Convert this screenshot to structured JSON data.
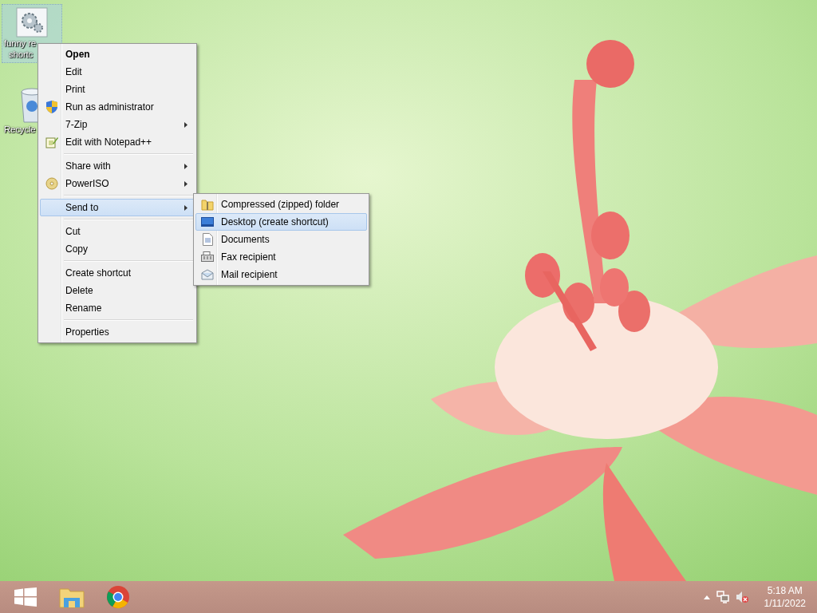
{
  "desktop_icons": [
    {
      "label_lines": [
        "funny re",
        "shortc"
      ],
      "selected": true
    },
    {
      "label_lines": [
        "Recycle"
      ],
      "selected": false
    }
  ],
  "context_menu": {
    "items": [
      {
        "kind": "item",
        "label": "Open",
        "default": true,
        "submenu": false,
        "selected": false
      },
      {
        "kind": "item",
        "label": "Edit",
        "default": false,
        "submenu": false,
        "selected": false
      },
      {
        "kind": "item",
        "label": "Print",
        "default": false,
        "submenu": false,
        "selected": false
      },
      {
        "kind": "item",
        "label": "Run as administrator",
        "default": false,
        "submenu": false,
        "selected": false
      },
      {
        "kind": "item",
        "label": "7-Zip",
        "default": false,
        "submenu": true,
        "selected": false
      },
      {
        "kind": "item",
        "label": "Edit with Notepad++",
        "default": false,
        "submenu": false,
        "selected": false
      },
      {
        "kind": "separator"
      },
      {
        "kind": "item",
        "label": "Share with",
        "default": false,
        "submenu": true,
        "selected": false
      },
      {
        "kind": "item",
        "label": "PowerISO",
        "default": false,
        "submenu": true,
        "selected": false
      },
      {
        "kind": "separator"
      },
      {
        "kind": "item",
        "label": "Send to",
        "default": false,
        "submenu": true,
        "selected": true
      },
      {
        "kind": "separator"
      },
      {
        "kind": "item",
        "label": "Cut",
        "default": false,
        "submenu": false,
        "selected": false
      },
      {
        "kind": "item",
        "label": "Copy",
        "default": false,
        "submenu": false,
        "selected": false
      },
      {
        "kind": "separator"
      },
      {
        "kind": "item",
        "label": "Create shortcut",
        "default": false,
        "submenu": false,
        "selected": false
      },
      {
        "kind": "item",
        "label": "Delete",
        "default": false,
        "submenu": false,
        "selected": false
      },
      {
        "kind": "item",
        "label": "Rename",
        "default": false,
        "submenu": false,
        "selected": false
      },
      {
        "kind": "separator"
      },
      {
        "kind": "item",
        "label": "Properties",
        "default": false,
        "submenu": false,
        "selected": false
      }
    ]
  },
  "send_to_menu": {
    "items": [
      {
        "label": "Compressed (zipped) folder",
        "selected": false
      },
      {
        "label": "Desktop (create shortcut)",
        "selected": true
      },
      {
        "label": "Documents",
        "selected": false
      },
      {
        "label": "Fax recipient",
        "selected": false
      },
      {
        "label": "Mail recipient",
        "selected": false
      }
    ]
  },
  "taskbar": {
    "time": "5:18 AM",
    "date": "1/11/2022"
  }
}
